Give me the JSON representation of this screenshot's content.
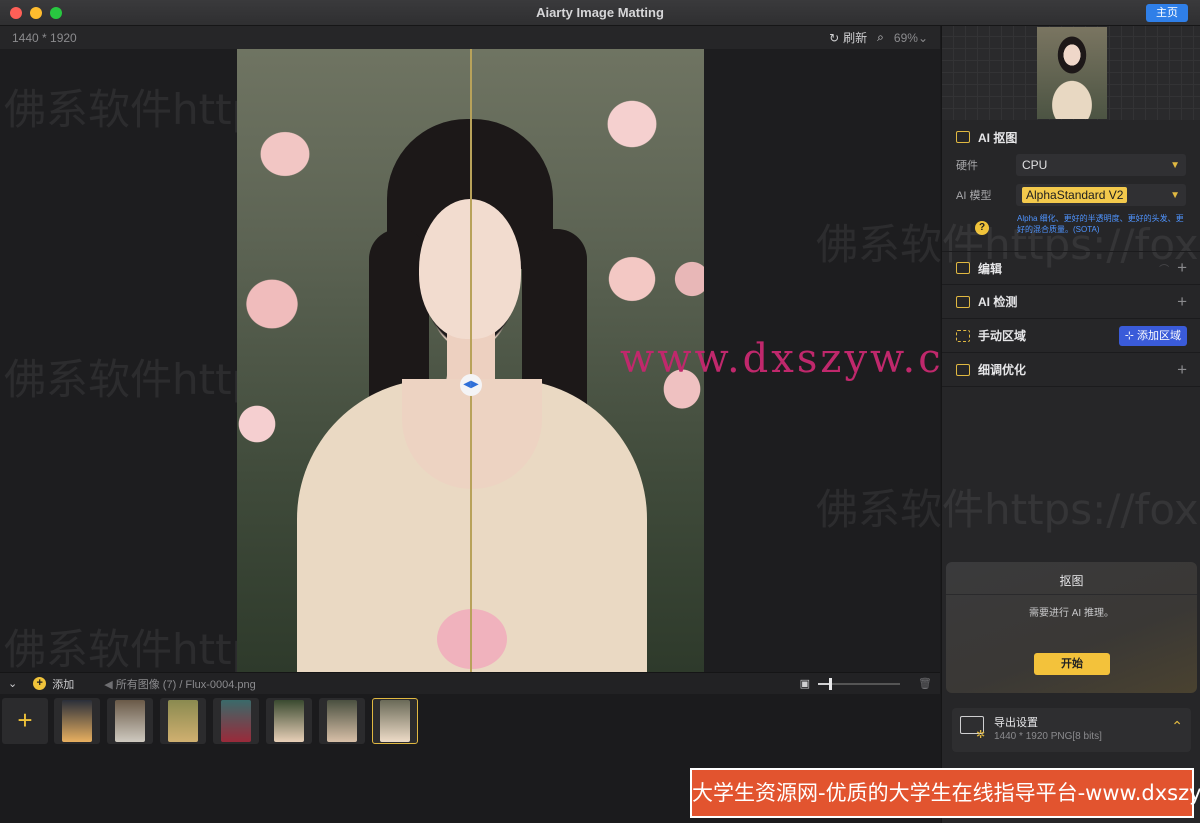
{
  "window": {
    "title": "Aiarty Image Matting",
    "home_button": "主页"
  },
  "canvas": {
    "dimensions": "1440 * 1920",
    "refresh_label": "刷新",
    "zoom": "69%",
    "split_position": 0.5
  },
  "watermarks": {
    "text": "佛系软件https://fox",
    "text_short": "佛系软件http",
    "url_overlay": "www.dxszyw.cn"
  },
  "sidebar": {
    "ai_matting": {
      "title": "AI 抠图",
      "hardware_label": "硬件",
      "hardware_value": "CPU",
      "model_label": "AI 模型",
      "model_value": "AlphaStandard  V2",
      "help_text": "Alpha 细化、更好的半透明度、更好的头发、更好的混合质量。(SOTA)"
    },
    "sections": [
      {
        "id": "edit",
        "label": "编辑"
      },
      {
        "id": "ai-detect",
        "label": "AI 检测"
      },
      {
        "id": "manual",
        "label": "手动区域",
        "action": "添加区域"
      },
      {
        "id": "refine",
        "label": "细调优化"
      }
    ],
    "matte_panel": {
      "title": "抠图",
      "message": "需要进行 AI 推理。",
      "button": "开始"
    },
    "export": {
      "title": "导出设置",
      "subtitle": "1440 * 1920 PNG[8 bits]"
    }
  },
  "filmstrip": {
    "add_label": "添加",
    "breadcrumb_all": "所有图像 (7)",
    "breadcrumb_file": "/ Flux-0004.png",
    "thumb_size": 0.15,
    "images": [
      {
        "name": "jellyfish",
        "colors": [
          "#2a2f3a",
          "#e8b060"
        ]
      },
      {
        "name": "rocks",
        "colors": [
          "#6a5a48",
          "#cfcac0"
        ]
      },
      {
        "name": "bicycle",
        "colors": [
          "#8a8a50",
          "#d0b070"
        ]
      },
      {
        "name": "forest-girl",
        "colors": [
          "#3a6a6a",
          "#9a2a3a"
        ]
      },
      {
        "name": "flower-girl-1",
        "colors": [
          "#3a4a30",
          "#e8d0b8"
        ]
      },
      {
        "name": "flower-girl-2",
        "colors": [
          "#4a5040",
          "#d8c0a8"
        ]
      },
      {
        "name": "flower-girl-3",
        "colors": [
          "#6a6a58",
          "#eedcc8"
        ]
      }
    ],
    "selected_index": 6
  },
  "banner": "大学生资源网-优质的大学生在线指导平台-www.dxszyw.cn"
}
